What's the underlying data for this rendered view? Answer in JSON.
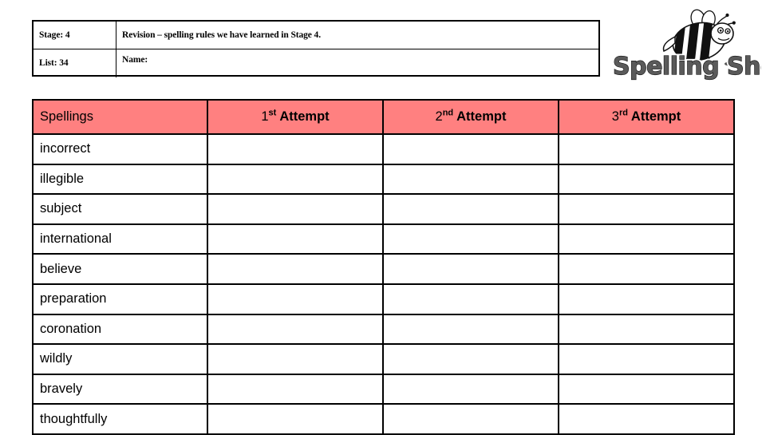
{
  "info": {
    "stage_label": "Stage: 4",
    "list_label": "List: 34",
    "revision_text": "Revision – spelling rules we have learned in Stage 4.",
    "name_label": "Name:"
  },
  "logo": {
    "wordmark": "Spelling Shed",
    "bee_icon_name": "bee-icon",
    "text_fill_color": "#5a5a5a",
    "outline_color": "#000000"
  },
  "table": {
    "header_bg_color": "#ff8080",
    "border_color": "#000000",
    "columns": [
      {
        "label": "Spellings",
        "ordinal": "",
        "key": "word"
      },
      {
        "label": "Attempt",
        "ordinal": "st",
        "number": "1",
        "key": "attempt1"
      },
      {
        "label": "Attempt",
        "ordinal": "nd",
        "number": "2",
        "key": "attempt2"
      },
      {
        "label": "Attempt",
        "ordinal": "rd",
        "number": "3",
        "key": "attempt3"
      }
    ],
    "rows": [
      {
        "word": "incorrect",
        "attempt1": "",
        "attempt2": "",
        "attempt3": ""
      },
      {
        "word": "illegible",
        "attempt1": "",
        "attempt2": "",
        "attempt3": ""
      },
      {
        "word": "subject",
        "attempt1": "",
        "attempt2": "",
        "attempt3": ""
      },
      {
        "word": "international",
        "attempt1": "",
        "attempt2": "",
        "attempt3": ""
      },
      {
        "word": "believe",
        "attempt1": "",
        "attempt2": "",
        "attempt3": ""
      },
      {
        "word": "preparation",
        "attempt1": "",
        "attempt2": "",
        "attempt3": ""
      },
      {
        "word": "coronation",
        "attempt1": "",
        "attempt2": "",
        "attempt3": ""
      },
      {
        "word": "wildly",
        "attempt1": "",
        "attempt2": "",
        "attempt3": ""
      },
      {
        "word": "bravely",
        "attempt1": "",
        "attempt2": "",
        "attempt3": ""
      },
      {
        "word": "thoughtfully",
        "attempt1": "",
        "attempt2": "",
        "attempt3": ""
      }
    ]
  }
}
